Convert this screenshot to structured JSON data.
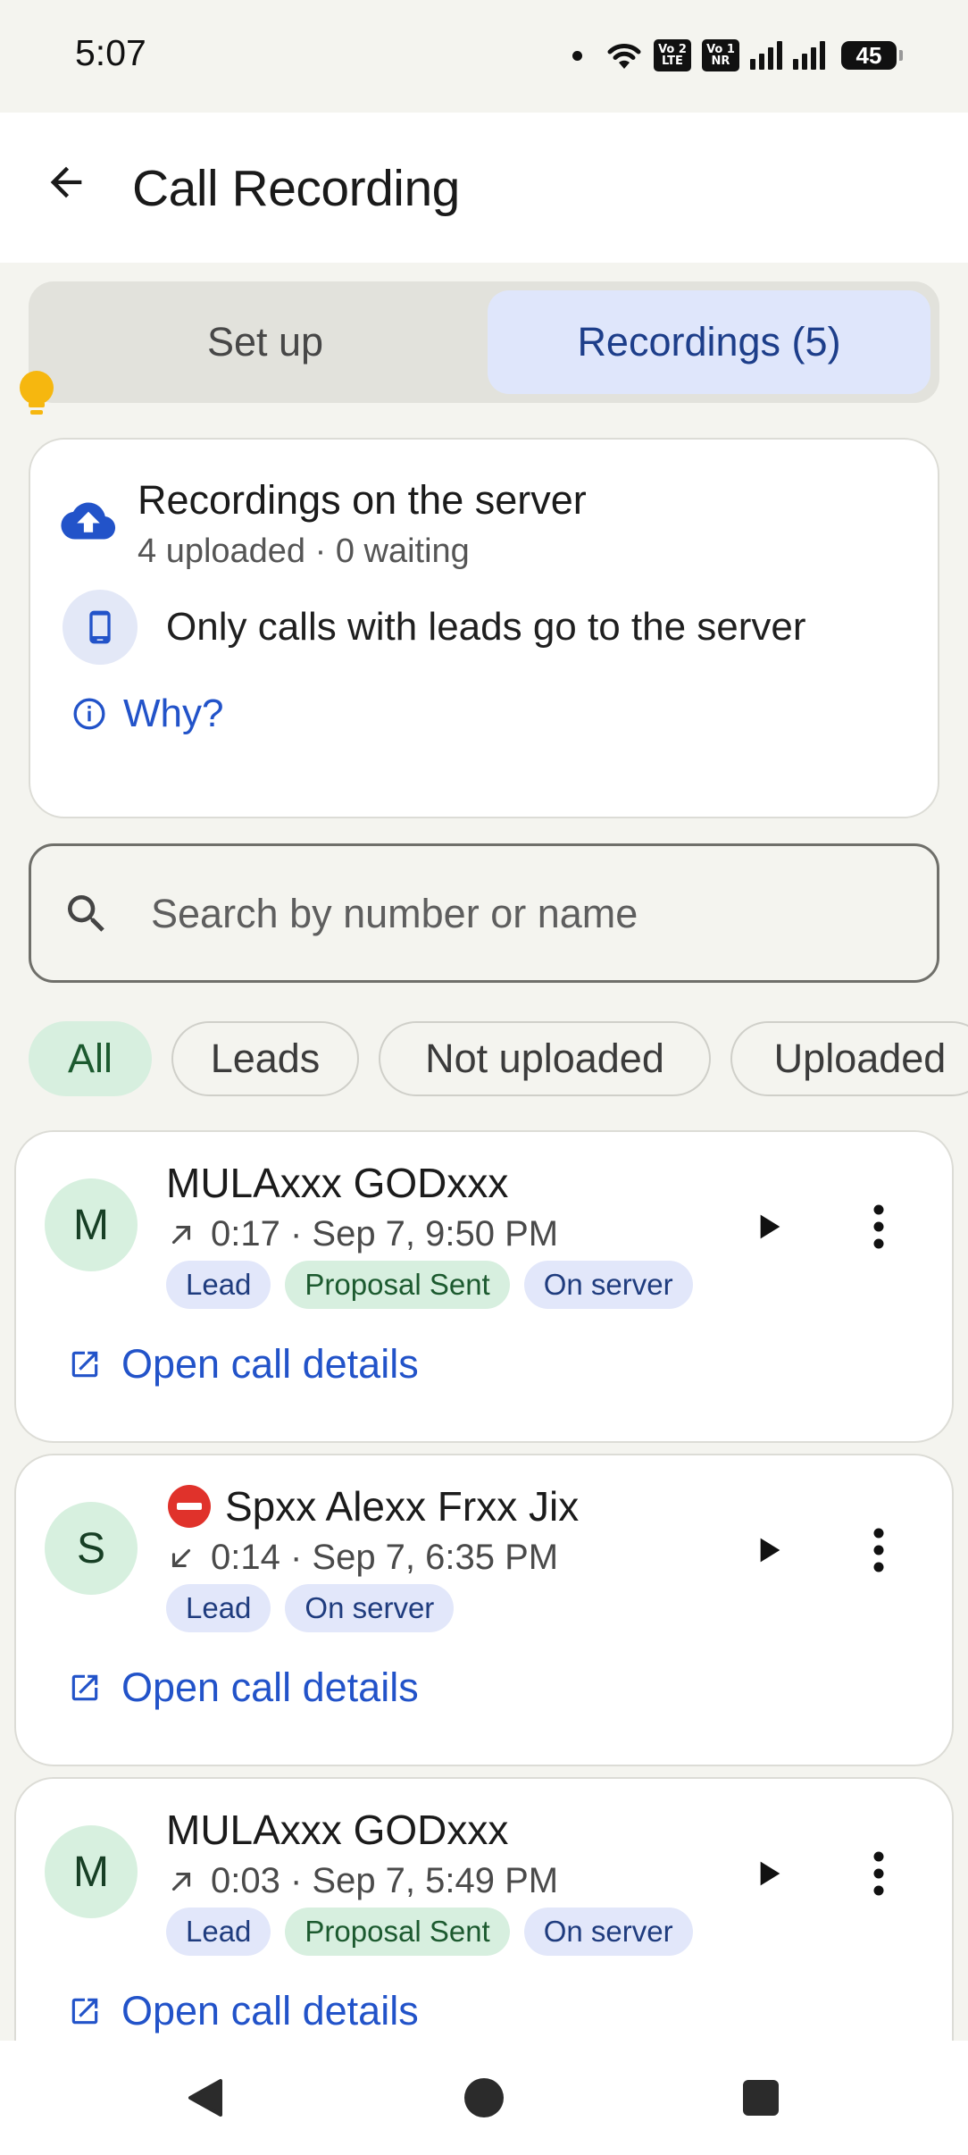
{
  "status_bar": {
    "time": "5:07",
    "sim1": {
      "top": "Vo",
      "bottom": "LTE",
      "num": "2"
    },
    "sim2": {
      "top": "Vo",
      "bottom": "NR",
      "num": "1"
    },
    "battery": "45"
  },
  "app_bar": {
    "title": "Call Recording",
    "back_icon": "arrow-back-icon"
  },
  "tabs": [
    {
      "label": "Set up",
      "selected": false
    },
    {
      "label": "Recordings (5)",
      "selected": true
    }
  ],
  "info_card": {
    "title": "Recordings on the server",
    "subtitle": "4 uploaded · 0 waiting",
    "note": "Only calls with leads go to the server",
    "why_label": "Why?"
  },
  "search": {
    "placeholder": "Search by number or name",
    "value": ""
  },
  "filters": [
    {
      "label": "All",
      "active": true
    },
    {
      "label": "Leads",
      "active": false
    },
    {
      "label": "Not uploaded",
      "active": false
    },
    {
      "label": "Uploaded",
      "active": false
    }
  ],
  "recordings": [
    {
      "initial": "M",
      "name": "MULAxxx GODxxx",
      "blocked": false,
      "direction": "outgoing",
      "meta": "0:17 · Sep 7, 9:50 PM",
      "tags": [
        "Lead",
        "Proposal Sent",
        "On server"
      ],
      "details_label": "Open call details"
    },
    {
      "initial": "S",
      "name": "Spxx Alexx Frxx Jix",
      "blocked": true,
      "direction": "incoming",
      "meta": "0:14 · Sep 7, 6:35 PM",
      "tags": [
        "Lead",
        "On server"
      ],
      "details_label": "Open call details"
    },
    {
      "initial": "M",
      "name": "MULAxxx GODxxx",
      "blocked": false,
      "direction": "outgoing",
      "meta": "0:03 · Sep 7, 5:49 PM",
      "tags": [
        "Lead",
        "Proposal Sent",
        "On server"
      ],
      "details_label": "Open call details"
    }
  ],
  "colors": {
    "accent_blue": "#2253c9",
    "background": "#f4f4ef",
    "green_chip": "#d7efdf",
    "blue_chip": "#e2e7fa"
  }
}
